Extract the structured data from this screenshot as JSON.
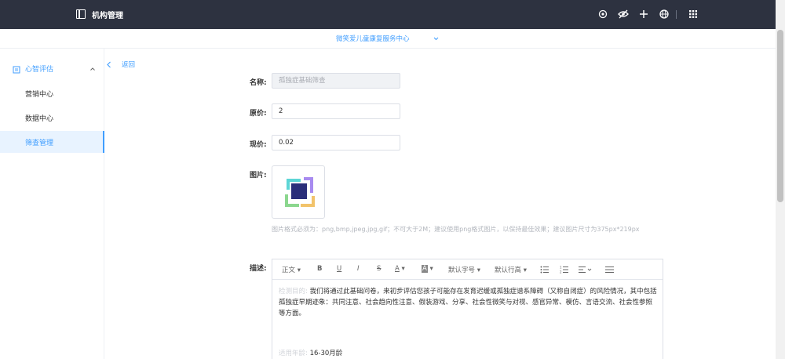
{
  "header": {
    "title": "机构管理",
    "icons": [
      "settings-icon",
      "eye-off-icon",
      "plus-icon",
      "globe-icon",
      "apps-grid-icon"
    ]
  },
  "org_selector": {
    "name": "微笑爱儿童康复服务中心",
    "icon": "chevron-down-icon"
  },
  "sidebar": {
    "group": {
      "label": "心智评估",
      "icon": "document-icon"
    },
    "items": [
      {
        "label": "营销中心"
      },
      {
        "label": "数据中心"
      },
      {
        "label": "筛查管理",
        "active": true
      }
    ]
  },
  "back": {
    "label": "返回"
  },
  "form": {
    "name": {
      "label": "名称:",
      "value": "孤独症基础筛查",
      "disabled": true
    },
    "original_price": {
      "label": "原价:",
      "value": "2"
    },
    "current_price": {
      "label": "现价:",
      "value": "0.02"
    },
    "image": {
      "label": "图片:",
      "hint": "图片格式必须为：png,bmp,jpeg,jpg,gif；不可大于2M；建议使用png格式图片，以保持最佳效果；建议图片尺寸为375px*219px"
    },
    "description": {
      "label": "描述:",
      "toolbar": {
        "text_style": "正文",
        "bold": "B",
        "underline": "U",
        "italic": "I",
        "strike": "S",
        "font_color": "A",
        "bg_color": "A",
        "font_size": "默认字号",
        "line_height": "默认行高"
      },
      "intro_label": "检测目的:",
      "intro_text": "我们将通过此基础问卷，来初步评估您孩子可能存在发育迟缓或孤独症谱系障碍（又称自闭症）的风险情况，其中包括孤独症早期迹象：共同注意、社会趋向性注意、假装游戏、分享、社会性微笑与对视、感官异常、模仿、言语交流、社会性参照等方面。",
      "age_label": "适用年龄:",
      "age_value": "16-30月龄"
    }
  },
  "colors": {
    "header_bg": "#2d3240",
    "accent": "#409eff",
    "active_bg": "#e8f3ff"
  }
}
